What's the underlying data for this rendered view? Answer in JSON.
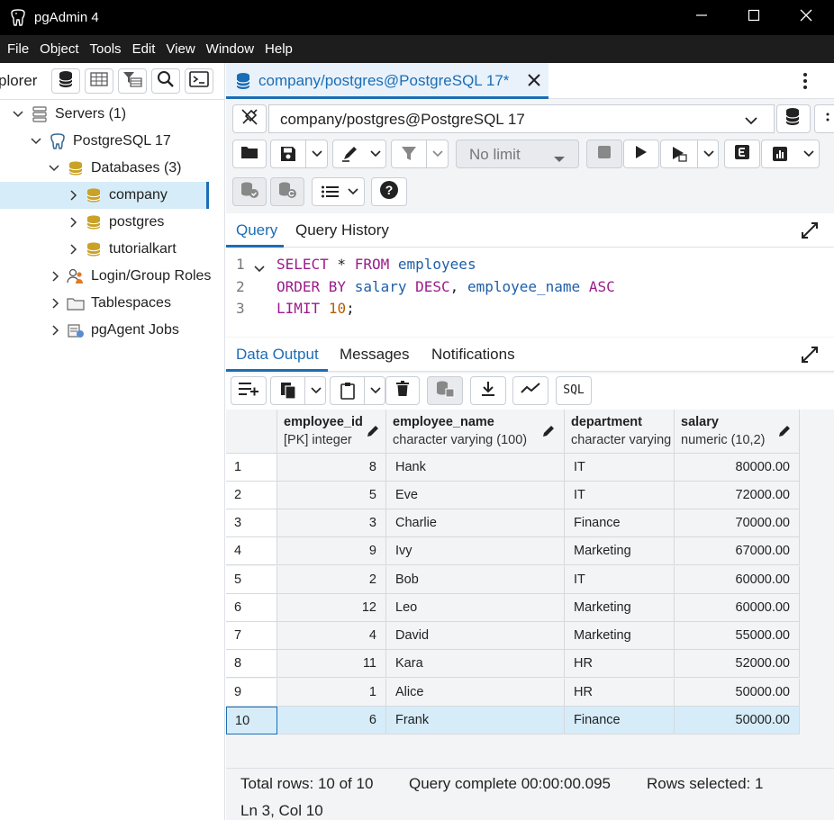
{
  "window": {
    "title": "pgAdmin 4",
    "controls": [
      "minimize-icon",
      "maximize-icon",
      "close-icon"
    ]
  },
  "menu": [
    "File",
    "Object",
    "Tools",
    "Edit",
    "View",
    "Window",
    "Help"
  ],
  "explorer": {
    "title": "plorer",
    "toolbar_icons": [
      "database-icon",
      "table-icon",
      "filter-table-icon",
      "search-icon",
      "terminal-icon"
    ],
    "tree": [
      {
        "label": "Servers (1)",
        "icon": "servers-icon",
        "expanded": true
      },
      {
        "label": "PostgreSQL 17",
        "icon": "elephant-icon",
        "expanded": true
      },
      {
        "label": "Databases (3)",
        "icon": "databases-icon",
        "expanded": true
      },
      {
        "label": "company",
        "icon": "database-icon",
        "expanded": false,
        "selected": true
      },
      {
        "label": "postgres",
        "icon": "database-icon",
        "expanded": false
      },
      {
        "label": "tutorialkart",
        "icon": "database-icon",
        "expanded": false
      },
      {
        "label": "Login/Group Roles",
        "icon": "roles-icon",
        "expanded": false
      },
      {
        "label": "Tablespaces",
        "icon": "folder-icon",
        "expanded": false
      },
      {
        "label": "pgAgent Jobs",
        "icon": "jobs-icon",
        "expanded": false
      }
    ]
  },
  "query_tab": {
    "label": "company/postgres@PostgreSQL 17*"
  },
  "connection": {
    "value": "company/postgres@PostgreSQL 17"
  },
  "toolbar": {
    "limit_value": "No limit"
  },
  "editor_tabs": [
    "Query",
    "Query History"
  ],
  "editor": {
    "line_numbers": [
      "1",
      "2",
      "3"
    ],
    "line1": {
      "kw1": "SELECT",
      "sym": " * ",
      "kw2": "FROM",
      "table": "employees"
    },
    "line2": {
      "kw1": "ORDER BY",
      "col1": "salary",
      "kw2": "DESC",
      "comma": ",",
      "col2": "employee_name",
      "kw3": "ASC"
    },
    "line3": {
      "kw1": "LIMIT",
      "num": "10",
      "semi": ";"
    }
  },
  "output_tabs": [
    "Data Output",
    "Messages",
    "Notifications"
  ],
  "grid": {
    "columns": [
      {
        "name": "employee_id",
        "type": "[PK] integer"
      },
      {
        "name": "employee_name",
        "type": "character varying (100)"
      },
      {
        "name": "department",
        "type": "character varying"
      },
      {
        "name": "salary",
        "type": "numeric (10,2)"
      }
    ],
    "rows": [
      {
        "n": "1",
        "id": "8",
        "name": "Hank",
        "dept": "IT",
        "salary": "80000.00"
      },
      {
        "n": "2",
        "id": "5",
        "name": "Eve",
        "dept": "IT",
        "salary": "72000.00"
      },
      {
        "n": "3",
        "id": "3",
        "name": "Charlie",
        "dept": "Finance",
        "salary": "70000.00"
      },
      {
        "n": "4",
        "id": "9",
        "name": "Ivy",
        "dept": "Marketing",
        "salary": "67000.00"
      },
      {
        "n": "5",
        "id": "2",
        "name": "Bob",
        "dept": "IT",
        "salary": "60000.00"
      },
      {
        "n": "6",
        "id": "12",
        "name": "Leo",
        "dept": "Marketing",
        "salary": "60000.00"
      },
      {
        "n": "7",
        "id": "4",
        "name": "David",
        "dept": "Marketing",
        "salary": "55000.00"
      },
      {
        "n": "8",
        "id": "11",
        "name": "Kara",
        "dept": "HR",
        "salary": "52000.00"
      },
      {
        "n": "9",
        "id": "1",
        "name": "Alice",
        "dept": "HR",
        "salary": "50000.00"
      },
      {
        "n": "10",
        "id": "6",
        "name": "Frank",
        "dept": "Finance",
        "salary": "50000.00"
      }
    ],
    "selected_row": "10"
  },
  "status": {
    "total_rows": "Total rows: 10 of 10",
    "query_complete": "Query complete 00:00:00.095",
    "rows_selected": "Rows selected: 1",
    "cursor": "Ln 3, Col 10"
  },
  "colors": {
    "accent": "#1b6db5",
    "selection": "#d6ecf8",
    "sql_keyword": "#9a1c8b",
    "sql_identifier": "#1f5fa8",
    "sql_number": "#b35f00"
  }
}
